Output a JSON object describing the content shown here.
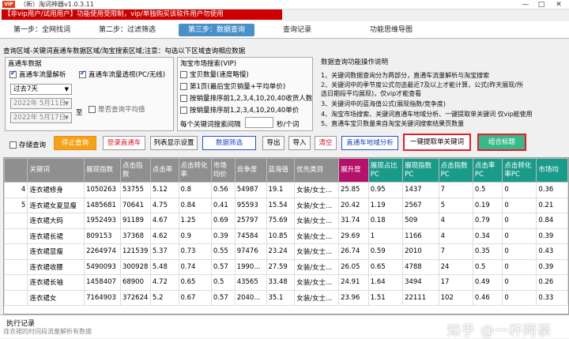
{
  "window": {
    "logo": "VIP",
    "title": "（新）淘词神器v1.0.3.11",
    "min": "—",
    "max": "□",
    "close": "✕"
  },
  "notice": "【非vip用户/试用用户】功能使用受限制，vip/单独购买该软件用户勿使用",
  "steps": [
    "第一步：全网找词",
    "第二步：过滤筛选",
    "第三步：数据查询",
    "查询记录",
    "功能思维导图"
  ],
  "crumb": "查询区域-关键词直通车数据区域/淘宝搜索区域;注意：勾选以下区域查询相应数据",
  "ztc": {
    "title": "直通车数据",
    "chk1": "直通车流量解析",
    "chk2": "直通车流量透视(PC/无线)",
    "range": "过去7天",
    "date_from": "2022年 5月11日",
    "date_to": "2022年 5月17日",
    "to": "至",
    "avg": "是否查询平均值"
  },
  "tb": {
    "title": "淘宝市场搜索(VIP)",
    "opt1": "宝贝数量(速度略慢)",
    "opt2": "第1页(最后宝贝销量+平均单价)",
    "opt3": "按销量排序前1,2,3,4,10,20,40收货人数",
    "opt4": "按销量排序前1,2,3,4,10,20,40单价",
    "interval_label": "每个关键词搜索间隔",
    "interval_unit": "秒/个词"
  },
  "help": {
    "title": "数据查询功能操作说明",
    "l1": "1、关键词数据查询分为两部分，直通车流量解析与淘宝搜索",
    "l2": "2、关键词中的季节度公式勿选最近7及以上才能计算，公式(昨天展现/所",
    "l3": "选日期段平均展现)，仅vip才能查看",
    "l4": "3、关键词中的蓝海值公式(展现指数/竞争度)",
    "l5": "4、淘宝市场搜索、关键词直通车地域分析、一键提取单关键词 仅vip能使用",
    "l6": "5、直通车宝贝数量来自淘宝关键词搜索结果页数量"
  },
  "buttons": {
    "save": "存储查询",
    "stop": "停止查询",
    "login": "登录直通车",
    "list_settings": "列表显示设置",
    "filter": "数据筛选",
    "export": "导出",
    "import": "导入",
    "clear": "清空",
    "region": "直通车地域分析",
    "extract": "一键提取单关键词",
    "combine": "组合标题"
  },
  "table": {
    "headers": [
      "",
      "关键词",
      "展现指数",
      "点击指数",
      "点击率",
      "点击转化率",
      "市场均价",
      "竞争度",
      "蓝海值",
      "优先类目",
      "展升度",
      "展现占比PC",
      "展现指数PC",
      "点击指数PC",
      "点击率PC",
      "点击转化率PC",
      "市场均"
    ],
    "rows": [
      [
        "4",
        "连衣裙修身",
        "1050263",
        "53755",
        "5.12",
        "0.8",
        "0.56",
        "54987",
        "19.1",
        "女装/女士...",
        "25.85",
        "0.95",
        "1437",
        "7",
        "0.5",
        "0",
        "0.36"
      ],
      [
        "5",
        "连衣裙女夏显瘦",
        "1485681",
        "70641",
        "4.75",
        "0.84",
        "0.41",
        "95593",
        "15.54",
        "女装/女士...",
        "20.42",
        "1.19",
        "2567",
        "5",
        "0.19",
        "0",
        "0.21"
      ],
      [
        "",
        "连衣裙大码",
        "1952493",
        "91189",
        "4.67",
        "1.25",
        "0.69",
        "25797",
        "75.69",
        "女装/女士...",
        "31.74",
        "0.18",
        "509",
        "4",
        "0.79",
        "0",
        "0.84"
      ],
      [
        "",
        "连衣裙长裙",
        "809153",
        "37368",
        "4.62",
        "0.9",
        "0.39",
        "74584",
        "10.85",
        "女装/女士...",
        "29.69",
        "1",
        "1166",
        "4",
        "0.34",
        "0",
        "0.39"
      ],
      [
        "",
        "连衣裙显瘦",
        "2264974",
        "121539",
        "5.37",
        "0.73",
        "0.55",
        "97476",
        "23.24",
        "女装/女士...",
        "26.74",
        "0.59",
        "2010",
        "7",
        "0.35",
        "0",
        "0.43"
      ],
      [
        "",
        "连衣裙收腰",
        "5490093",
        "300928",
        "5.48",
        "0.74",
        "0.57",
        "1990...",
        "27.59",
        "女装/女士...",
        "26.05",
        "0.65",
        "4788",
        "24",
        "0.5",
        "0",
        "0.39"
      ],
      [
        "",
        "连衣裙长袖",
        "1458407",
        "68900",
        "4.72",
        "0.65",
        "0.5",
        "43565",
        "33.48",
        "女装/女士...",
        "24.91",
        "1.64",
        "3494",
        "17",
        "0.49",
        "0",
        "0.26"
      ],
      [
        "",
        "连衣裙女",
        "7164903",
        "372624",
        "5.2",
        "0.67",
        "0.57",
        "2040...",
        "35.1",
        "女装/女士...",
        "23.96",
        "1.51",
        "22111",
        "102",
        "0.46",
        "0",
        "0.33"
      ]
    ]
  },
  "exec": {
    "label": "执行记录",
    "log": "连衣裙的时间段流量解析有数据"
  },
  "watermark": "知乎 @一杯阿荼",
  "colors": {
    "accent": "#4a90c8",
    "notice_bg": "#cc0000",
    "header_gray": "#8f8f8f",
    "header_magenta": "#b5106a",
    "header_teal": "#1a9b8a",
    "stop_orange": "#f5a21a",
    "combine_green": "#39b98a"
  }
}
